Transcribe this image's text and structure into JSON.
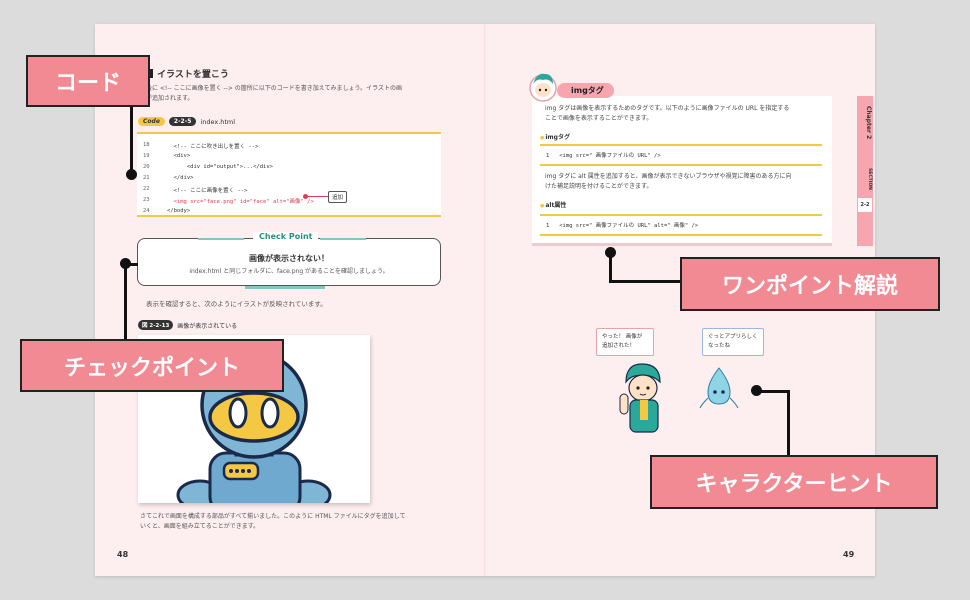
{
  "left_page": {
    "section_title": "イラストを置こう",
    "intro_line1": "最後に <!-- ここに画像を置く --> の箇所に以下のコードを書き加えてみましょう。イラストの画",
    "intro_line2": "像が追加されます。",
    "code_label": "Code",
    "code_number": "2-2-5",
    "code_filename": "index.html",
    "code_lines": [
      {
        "no": "18",
        "text": "  <!-- ここに吹き出しを置く -->"
      },
      {
        "no": "19",
        "text": "  <div>"
      },
      {
        "no": "20",
        "text": "      <div id=\"output\">...</div>"
      },
      {
        "no": "21",
        "text": "  </div>"
      },
      {
        "no": "22",
        "text": "  <!-- ここに画像を置く -->"
      },
      {
        "no": "23",
        "text": "  <img src=\"face.png\" id=\"face\" alt=\"画像\" />"
      },
      {
        "no": "24",
        "text": "</body>"
      }
    ],
    "add_badge": "追加",
    "checkpoint_tab": "Check Point",
    "checkpoint_heading": "画像が表示されない！",
    "checkpoint_body": "index.html と同じフォルダに、face.png があることを確認しましょう。",
    "para2": "表示を確認すると、次のようにイラストが反映されています。",
    "figure_number": "図 2-2-13",
    "figure_caption": "画像が表示されている",
    "para3_line1": "さてこれで画面を構成する部品がすべて揃いました。このように HTML ファイルにタグを追加して",
    "para3_line2": "いくと、画面を組み立てることができます。",
    "page_number": "48"
  },
  "right_page": {
    "tag_title": "imgタグ",
    "text1_line1": "img タグは画像を表示するためのタグです。以下のように画像ファイルの URL を指定する",
    "text1_line2": "ことで画像を表示することができます。",
    "sub1": "imgタグ",
    "code1": "1   <img src=\" 画像ファイルの URL\" />",
    "text2_line1": "img タグに alt 属性を追加すると、画像が表示できないブラウザや視覚に障害のある方に向",
    "text2_line2": "けた補足説明を付けることができます。",
    "sub2": "alt属性",
    "code2": "1   <img src=\" 画像ファイルの URL\" alt=\" 画像\" />",
    "side_chapter": "Chapter 2",
    "side_section": "SECTION",
    "side_number": "2-2",
    "bubble1_line1": "やった！ 画像が",
    "bubble1_line2": "追加された！",
    "bubble2_line1": "ぐっとアプリらしく",
    "bubble2_line2": "なったね",
    "page_number": "49"
  },
  "callouts": {
    "code": "コード",
    "checkpoint": "チェックポイント",
    "onepoint": "ワンポイント解説",
    "character": "キャラクターヒント"
  },
  "colors": {
    "page_bg": "#fdeef0",
    "accent_pink": "#f28a94",
    "accent_yellow": "#f4c842",
    "accent_teal": "#7fc9c1",
    "code_red": "#e03c4f"
  }
}
